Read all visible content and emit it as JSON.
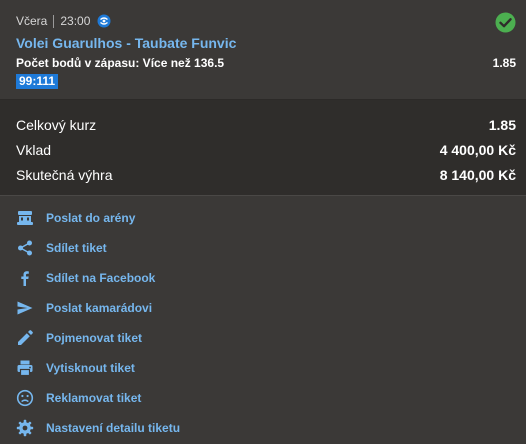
{
  "bet": {
    "day": "Včera",
    "time": "23:00",
    "event": "Volei Guarulhos - Taubate Funvic",
    "market": "Počet bodů v zápasu: Více než 136.5",
    "odds": "1.85",
    "score": "99:111",
    "status_icon": "check-circle-icon",
    "live_icon": "live-stream-icon"
  },
  "summary": {
    "total_odds_label": "Celkový kurz",
    "total_odds_value": "1.85",
    "stake_label": "Vklad",
    "stake_value": "4 400,00 Kč",
    "win_label": "Skutečná výhra",
    "win_value": "8 140,00 Kč"
  },
  "actions": [
    {
      "label": "Poslat do arény",
      "icon": "arena-icon"
    },
    {
      "label": "Sdílet tiket",
      "icon": "share-icon"
    },
    {
      "label": "Sdílet na Facebook",
      "icon": "facebook-icon"
    },
    {
      "label": "Poslat kamarádovi",
      "icon": "send-icon"
    },
    {
      "label": "Pojmenovat tiket",
      "icon": "pencil-icon"
    },
    {
      "label": "Vytisknout tiket",
      "icon": "printer-icon"
    },
    {
      "label": "Reklamovat tiket",
      "icon": "sad-face-icon"
    },
    {
      "label": "Nastavení detailu tiketu",
      "icon": "gear-icon"
    }
  ],
  "colors": {
    "link": "#76b7ee",
    "success": "#4caf50",
    "score_bg": "#1e7ad8",
    "background": "#3b3937",
    "summary_bg": "#2f2d2b"
  }
}
